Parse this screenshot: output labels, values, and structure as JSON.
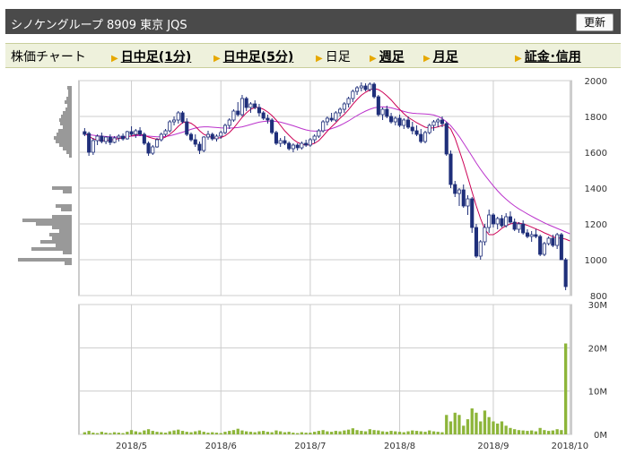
{
  "header": {
    "title": "シノケングループ 8909 東京 JQS",
    "refresh_label": "更新"
  },
  "tabs": [
    {
      "label": "株価チャート",
      "link": false,
      "arrow": false
    },
    {
      "label": "日中足(1分)",
      "link": true,
      "arrow": true
    },
    {
      "label": "日中足(5分)",
      "link": true,
      "arrow": true
    },
    {
      "label": "日足",
      "link": false,
      "arrow": true
    },
    {
      "label": "週足",
      "link": true,
      "arrow": true
    },
    {
      "label": "月足",
      "link": true,
      "arrow": true
    },
    {
      "label": "証金･信用",
      "link": true,
      "arrow": true
    }
  ],
  "colors": {
    "up_candle": "#ffffff",
    "down_candle": "#1f2f7a",
    "moving_average_short": "#cc0055",
    "moving_average_long": "#bb33cc",
    "volume_bar": "#8db53a",
    "price_profile_bar": "#999999",
    "grid": "#cccccc"
  },
  "chart_data": {
    "type": "candlestick",
    "price_axis": {
      "ticks": [
        "2000",
        "1800",
        "1600",
        "1400",
        "1200",
        "1000",
        "800"
      ],
      "ylim": [
        800,
        2000
      ]
    },
    "volume_axis": {
      "ticks": [
        "30M",
        "20M",
        "10M",
        "0M"
      ],
      "ylim": [
        0,
        30
      ]
    },
    "x_ticks": [
      "2018/5",
      "2018/6",
      "2018/7",
      "2018/8",
      "2018/9",
      "2018/10"
    ],
    "x_tick_index": [
      11,
      32,
      53,
      74,
      96,
      114
    ],
    "candles": [
      [
        1715,
        1735,
        1690,
        1700
      ],
      [
        1705,
        1715,
        1580,
        1600
      ],
      [
        1600,
        1680,
        1585,
        1665
      ],
      [
        1665,
        1700,
        1640,
        1690
      ],
      [
        1690,
        1710,
        1650,
        1660
      ],
      [
        1660,
        1690,
        1645,
        1685
      ],
      [
        1685,
        1700,
        1640,
        1655
      ],
      [
        1655,
        1690,
        1650,
        1680
      ],
      [
        1680,
        1700,
        1660,
        1690
      ],
      [
        1690,
        1705,
        1665,
        1675
      ],
      [
        1675,
        1720,
        1670,
        1715
      ],
      [
        1715,
        1745,
        1690,
        1700
      ],
      [
        1700,
        1730,
        1680,
        1720
      ],
      [
        1720,
        1740,
        1690,
        1700
      ],
      [
        1700,
        1710,
        1640,
        1650
      ],
      [
        1650,
        1660,
        1580,
        1595
      ],
      [
        1595,
        1640,
        1585,
        1630
      ],
      [
        1630,
        1680,
        1625,
        1670
      ],
      [
        1670,
        1710,
        1660,
        1700
      ],
      [
        1700,
        1730,
        1690,
        1720
      ],
      [
        1720,
        1780,
        1710,
        1770
      ],
      [
        1770,
        1800,
        1750,
        1780
      ],
      [
        1780,
        1830,
        1760,
        1820
      ],
      [
        1820,
        1830,
        1760,
        1770
      ],
      [
        1770,
        1790,
        1690,
        1700
      ],
      [
        1700,
        1710,
        1660,
        1670
      ],
      [
        1670,
        1700,
        1630,
        1645
      ],
      [
        1645,
        1660,
        1590,
        1610
      ],
      [
        1610,
        1690,
        1600,
        1685
      ],
      [
        1685,
        1720,
        1670,
        1700
      ],
      [
        1700,
        1710,
        1665,
        1675
      ],
      [
        1675,
        1700,
        1660,
        1690
      ],
      [
        1690,
        1720,
        1675,
        1710
      ],
      [
        1710,
        1760,
        1700,
        1750
      ],
      [
        1750,
        1790,
        1730,
        1780
      ],
      [
        1780,
        1840,
        1770,
        1830
      ],
      [
        1830,
        1880,
        1800,
        1810
      ],
      [
        1810,
        1920,
        1800,
        1900
      ],
      [
        1900,
        1910,
        1830,
        1850
      ],
      [
        1850,
        1880,
        1820,
        1870
      ],
      [
        1870,
        1890,
        1840,
        1850
      ],
      [
        1850,
        1870,
        1800,
        1820
      ],
      [
        1820,
        1830,
        1780,
        1790
      ],
      [
        1790,
        1810,
        1760,
        1780
      ],
      [
        1780,
        1790,
        1700,
        1710
      ],
      [
        1710,
        1720,
        1640,
        1650
      ],
      [
        1650,
        1680,
        1630,
        1665
      ],
      [
        1665,
        1690,
        1640,
        1650
      ],
      [
        1650,
        1660,
        1610,
        1620
      ],
      [
        1620,
        1650,
        1600,
        1640
      ],
      [
        1640,
        1650,
        1610,
        1625
      ],
      [
        1625,
        1660,
        1615,
        1650
      ],
      [
        1650,
        1670,
        1630,
        1640
      ],
      [
        1640,
        1680,
        1630,
        1670
      ],
      [
        1670,
        1700,
        1650,
        1690
      ],
      [
        1690,
        1730,
        1680,
        1720
      ],
      [
        1720,
        1780,
        1710,
        1770
      ],
      [
        1770,
        1800,
        1750,
        1790
      ],
      [
        1790,
        1820,
        1770,
        1780
      ],
      [
        1780,
        1830,
        1770,
        1820
      ],
      [
        1820,
        1850,
        1800,
        1840
      ],
      [
        1840,
        1880,
        1820,
        1870
      ],
      [
        1870,
        1910,
        1850,
        1900
      ],
      [
        1900,
        1950,
        1880,
        1940
      ],
      [
        1940,
        1970,
        1920,
        1960
      ],
      [
        1960,
        1990,
        1940,
        1970
      ],
      [
        1970,
        1985,
        1940,
        1950
      ],
      [
        1950,
        1990,
        1940,
        1980
      ],
      [
        1980,
        1990,
        1900,
        1910
      ],
      [
        1910,
        1920,
        1800,
        1810
      ],
      [
        1810,
        1850,
        1780,
        1840
      ],
      [
        1840,
        1860,
        1790,
        1800
      ],
      [
        1800,
        1820,
        1760,
        1770
      ],
      [
        1770,
        1800,
        1750,
        1790
      ],
      [
        1790,
        1810,
        1740,
        1750
      ],
      [
        1750,
        1790,
        1730,
        1780
      ],
      [
        1780,
        1800,
        1730,
        1740
      ],
      [
        1740,
        1770,
        1700,
        1720
      ],
      [
        1720,
        1750,
        1690,
        1700
      ],
      [
        1700,
        1730,
        1650,
        1660
      ],
      [
        1660,
        1720,
        1650,
        1710
      ],
      [
        1710,
        1760,
        1700,
        1750
      ],
      [
        1750,
        1780,
        1720,
        1770
      ],
      [
        1770,
        1790,
        1740,
        1780
      ],
      [
        1780,
        1800,
        1740,
        1760
      ],
      [
        1760,
        1770,
        1580,
        1590
      ],
      [
        1590,
        1610,
        1400,
        1420
      ],
      [
        1420,
        1440,
        1350,
        1370
      ],
      [
        1370,
        1400,
        1300,
        1390
      ],
      [
        1390,
        1420,
        1290,
        1300
      ],
      [
        1300,
        1360,
        1250,
        1340
      ],
      [
        1340,
        1350,
        1150,
        1180
      ],
      [
        1180,
        1200,
        1010,
        1020
      ],
      [
        1020,
        1110,
        1000,
        1100
      ],
      [
        1100,
        1200,
        1080,
        1180
      ],
      [
        1180,
        1280,
        1150,
        1250
      ],
      [
        1250,
        1260,
        1180,
        1200
      ],
      [
        1200,
        1240,
        1170,
        1230
      ],
      [
        1230,
        1250,
        1180,
        1190
      ],
      [
        1190,
        1260,
        1180,
        1240
      ],
      [
        1240,
        1270,
        1200,
        1210
      ],
      [
        1210,
        1230,
        1160,
        1170
      ],
      [
        1170,
        1210,
        1150,
        1200
      ],
      [
        1200,
        1220,
        1140,
        1150
      ],
      [
        1150,
        1170,
        1120,
        1130
      ],
      [
        1130,
        1160,
        1100,
        1140
      ],
      [
        1140,
        1170,
        1120,
        1130
      ],
      [
        1130,
        1140,
        1020,
        1030
      ],
      [
        1030,
        1100,
        1020,
        1090
      ],
      [
        1090,
        1130,
        1080,
        1120
      ],
      [
        1120,
        1140,
        1070,
        1080
      ],
      [
        1080,
        1150,
        1060,
        1140
      ],
      [
        1140,
        1150,
        1010,
        1000
      ],
      [
        1000,
        1010,
        830,
        850
      ]
    ],
    "volume_millions": [
      0.5,
      0.8,
      0.4,
      0.3,
      0.6,
      0.4,
      0.3,
      0.5,
      0.4,
      0.3,
      0.6,
      1.0,
      0.7,
      0.5,
      0.9,
      1.2,
      0.8,
      0.6,
      0.5,
      0.4,
      0.7,
      0.9,
      1.1,
      0.8,
      0.6,
      0.5,
      0.7,
      0.9,
      0.6,
      0.4,
      0.5,
      0.4,
      0.3,
      0.6,
      0.8,
      1.0,
      1.3,
      0.9,
      0.7,
      0.6,
      0.5,
      0.7,
      0.8,
      0.6,
      0.5,
      0.9,
      0.7,
      0.5,
      0.6,
      0.4,
      0.3,
      0.5,
      0.4,
      0.4,
      0.6,
      0.8,
      1.0,
      0.7,
      0.6,
      0.8,
      0.7,
      0.9,
      1.1,
      1.4,
      1.0,
      0.8,
      0.7,
      1.2,
      1.0,
      0.9,
      0.7,
      0.6,
      0.8,
      0.7,
      0.6,
      0.5,
      0.7,
      0.9,
      0.8,
      0.7,
      0.6,
      0.9,
      0.7,
      0.6,
      0.5,
      4.5,
      3.0,
      5.0,
      4.5,
      2.0,
      3.5,
      6.0,
      5.0,
      3.0,
      5.5,
      4.0,
      3.0,
      2.5,
      3.0,
      2.0,
      1.5,
      1.2,
      1.0,
      0.9,
      0.8,
      0.9,
      0.7,
      1.5,
      1.0,
      0.8,
      0.9,
      1.2,
      1.0,
      21.0
    ],
    "ma_short": [
      1705,
      1690,
      1675,
      1668,
      1665,
      1665,
      1668,
      1672,
      1676,
      1680,
      1686,
      1692,
      1696,
      1700,
      1695,
      1685,
      1678,
      1672,
      1675,
      1685,
      1700,
      1720,
      1745,
      1765,
      1770,
      1762,
      1745,
      1720,
      1700,
      1690,
      1682,
      1678,
      1682,
      1692,
      1710,
      1735,
      1765,
      1795,
      1820,
      1840,
      1850,
      1850,
      1840,
      1825,
      1805,
      1780,
      1750,
      1720,
      1695,
      1672,
      1655,
      1645,
      1640,
      1642,
      1650,
      1665,
      1690,
      1718,
      1742,
      1765,
      1790,
      1812,
      1838,
      1868,
      1895,
      1918,
      1935,
      1948,
      1955,
      1950,
      1935,
      1915,
      1892,
      1865,
      1840,
      1815,
      1795,
      1780,
      1765,
      1752,
      1740,
      1735,
      1736,
      1742,
      1750,
      1752,
      1730,
      1680,
      1610,
      1540,
      1460,
      1380,
      1300,
      1230,
      1170,
      1140,
      1140,
      1155,
      1175,
      1190,
      1200,
      1205,
      1205,
      1200,
      1192,
      1182,
      1172,
      1162,
      1150,
      1140,
      1128,
      1122,
      1120,
      1115,
      1105
    ],
    "ma_long": [
      1700,
      1698,
      1695,
      1692,
      1690,
      1688,
      1686,
      1685,
      1685,
      1686,
      1688,
      1690,
      1692,
      1693,
      1692,
      1690,
      1688,
      1686,
      1686,
      1688,
      1692,
      1698,
      1705,
      1712,
      1720,
      1728,
      1735,
      1740,
      1742,
      1742,
      1740,
      1738,
      1736,
      1735,
      1735,
      1736,
      1738,
      1742,
      1748,
      1755,
      1762,
      1768,
      1772,
      1774,
      1774,
      1772,
      1768,
      1762,
      1755,
      1748,
      1740,
      1732,
      1725,
      1720,
      1718,
      1718,
      1720,
      1725,
      1732,
      1740,
      1750,
      1762,
      1775,
      1790,
      1805,
      1818,
      1830,
      1840,
      1848,
      1852,
      1854,
      1852,
      1848,
      1842,
      1835,
      1828,
      1822,
      1818,
      1816,
      1815,
      1814,
      1812,
      1808,
      1800,
      1788,
      1770,
      1748,
      1720,
      1688,
      1652,
      1615,
      1578,
      1540,
      1505,
      1472,
      1442,
      1412,
      1385,
      1360,
      1338,
      1318,
      1300,
      1284,
      1270,
      1256,
      1243,
      1230,
      1218,
      1206,
      1195,
      1185,
      1175,
      1165,
      1155,
      1145
    ],
    "price_profile": [
      {
        "price": 1960,
        "w": 5
      },
      {
        "price": 1940,
        "w": 4
      },
      {
        "price": 1920,
        "w": 4
      },
      {
        "price": 1900,
        "w": 6
      },
      {
        "price": 1880,
        "w": 8
      },
      {
        "price": 1860,
        "w": 5
      },
      {
        "price": 1840,
        "w": 7
      },
      {
        "price": 1820,
        "w": 10
      },
      {
        "price": 1800,
        "w": 12
      },
      {
        "price": 1780,
        "w": 14
      },
      {
        "price": 1760,
        "w": 13
      },
      {
        "price": 1740,
        "w": 10
      },
      {
        "price": 1720,
        "w": 15
      },
      {
        "price": 1700,
        "w": 17
      },
      {
        "price": 1680,
        "w": 20
      },
      {
        "price": 1660,
        "w": 18
      },
      {
        "price": 1640,
        "w": 14
      },
      {
        "price": 1620,
        "w": 10
      },
      {
        "price": 1600,
        "w": 6
      },
      {
        "price": 1580,
        "w": 3
      },
      {
        "price": 1400,
        "w": 22
      },
      {
        "price": 1380,
        "w": 10
      },
      {
        "price": 1300,
        "w": 18
      },
      {
        "price": 1280,
        "w": 12
      },
      {
        "price": 1240,
        "w": 22
      },
      {
        "price": 1220,
        "w": 55
      },
      {
        "price": 1200,
        "w": 40
      },
      {
        "price": 1180,
        "w": 22
      },
      {
        "price": 1160,
        "w": 14
      },
      {
        "price": 1140,
        "w": 25
      },
      {
        "price": 1120,
        "w": 22
      },
      {
        "price": 1100,
        "w": 35
      },
      {
        "price": 1080,
        "w": 18
      },
      {
        "price": 1060,
        "w": 45
      },
      {
        "price": 1040,
        "w": 10
      },
      {
        "price": 1000,
        "w": 60
      },
      {
        "price": 980,
        "w": 8
      }
    ]
  }
}
